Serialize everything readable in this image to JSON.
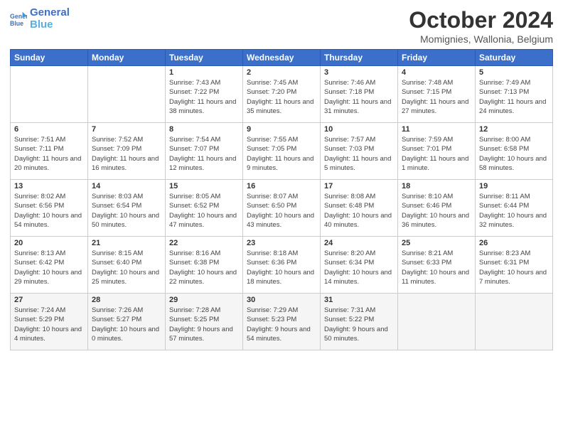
{
  "header": {
    "logo_line1": "General",
    "logo_line2": "Blue",
    "month": "October 2024",
    "location": "Momignies, Wallonia, Belgium"
  },
  "days_of_week": [
    "Sunday",
    "Monday",
    "Tuesday",
    "Wednesday",
    "Thursday",
    "Friday",
    "Saturday"
  ],
  "weeks": [
    [
      {
        "day": "",
        "info": ""
      },
      {
        "day": "",
        "info": ""
      },
      {
        "day": "1",
        "info": "Sunrise: 7:43 AM\nSunset: 7:22 PM\nDaylight: 11 hours and 38 minutes."
      },
      {
        "day": "2",
        "info": "Sunrise: 7:45 AM\nSunset: 7:20 PM\nDaylight: 11 hours and 35 minutes."
      },
      {
        "day": "3",
        "info": "Sunrise: 7:46 AM\nSunset: 7:18 PM\nDaylight: 11 hours and 31 minutes."
      },
      {
        "day": "4",
        "info": "Sunrise: 7:48 AM\nSunset: 7:15 PM\nDaylight: 11 hours and 27 minutes."
      },
      {
        "day": "5",
        "info": "Sunrise: 7:49 AM\nSunset: 7:13 PM\nDaylight: 11 hours and 24 minutes."
      }
    ],
    [
      {
        "day": "6",
        "info": "Sunrise: 7:51 AM\nSunset: 7:11 PM\nDaylight: 11 hours and 20 minutes."
      },
      {
        "day": "7",
        "info": "Sunrise: 7:52 AM\nSunset: 7:09 PM\nDaylight: 11 hours and 16 minutes."
      },
      {
        "day": "8",
        "info": "Sunrise: 7:54 AM\nSunset: 7:07 PM\nDaylight: 11 hours and 12 minutes."
      },
      {
        "day": "9",
        "info": "Sunrise: 7:55 AM\nSunset: 7:05 PM\nDaylight: 11 hours and 9 minutes."
      },
      {
        "day": "10",
        "info": "Sunrise: 7:57 AM\nSunset: 7:03 PM\nDaylight: 11 hours and 5 minutes."
      },
      {
        "day": "11",
        "info": "Sunrise: 7:59 AM\nSunset: 7:01 PM\nDaylight: 11 hours and 1 minute."
      },
      {
        "day": "12",
        "info": "Sunrise: 8:00 AM\nSunset: 6:58 PM\nDaylight: 10 hours and 58 minutes."
      }
    ],
    [
      {
        "day": "13",
        "info": "Sunrise: 8:02 AM\nSunset: 6:56 PM\nDaylight: 10 hours and 54 minutes."
      },
      {
        "day": "14",
        "info": "Sunrise: 8:03 AM\nSunset: 6:54 PM\nDaylight: 10 hours and 50 minutes."
      },
      {
        "day": "15",
        "info": "Sunrise: 8:05 AM\nSunset: 6:52 PM\nDaylight: 10 hours and 47 minutes."
      },
      {
        "day": "16",
        "info": "Sunrise: 8:07 AM\nSunset: 6:50 PM\nDaylight: 10 hours and 43 minutes."
      },
      {
        "day": "17",
        "info": "Sunrise: 8:08 AM\nSunset: 6:48 PM\nDaylight: 10 hours and 40 minutes."
      },
      {
        "day": "18",
        "info": "Sunrise: 8:10 AM\nSunset: 6:46 PM\nDaylight: 10 hours and 36 minutes."
      },
      {
        "day": "19",
        "info": "Sunrise: 8:11 AM\nSunset: 6:44 PM\nDaylight: 10 hours and 32 minutes."
      }
    ],
    [
      {
        "day": "20",
        "info": "Sunrise: 8:13 AM\nSunset: 6:42 PM\nDaylight: 10 hours and 29 minutes."
      },
      {
        "day": "21",
        "info": "Sunrise: 8:15 AM\nSunset: 6:40 PM\nDaylight: 10 hours and 25 minutes."
      },
      {
        "day": "22",
        "info": "Sunrise: 8:16 AM\nSunset: 6:38 PM\nDaylight: 10 hours and 22 minutes."
      },
      {
        "day": "23",
        "info": "Sunrise: 8:18 AM\nSunset: 6:36 PM\nDaylight: 10 hours and 18 minutes."
      },
      {
        "day": "24",
        "info": "Sunrise: 8:20 AM\nSunset: 6:34 PM\nDaylight: 10 hours and 14 minutes."
      },
      {
        "day": "25",
        "info": "Sunrise: 8:21 AM\nSunset: 6:33 PM\nDaylight: 10 hours and 11 minutes."
      },
      {
        "day": "26",
        "info": "Sunrise: 8:23 AM\nSunset: 6:31 PM\nDaylight: 10 hours and 7 minutes."
      }
    ],
    [
      {
        "day": "27",
        "info": "Sunrise: 7:24 AM\nSunset: 5:29 PM\nDaylight: 10 hours and 4 minutes."
      },
      {
        "day": "28",
        "info": "Sunrise: 7:26 AM\nSunset: 5:27 PM\nDaylight: 10 hours and 0 minutes."
      },
      {
        "day": "29",
        "info": "Sunrise: 7:28 AM\nSunset: 5:25 PM\nDaylight: 9 hours and 57 minutes."
      },
      {
        "day": "30",
        "info": "Sunrise: 7:29 AM\nSunset: 5:23 PM\nDaylight: 9 hours and 54 minutes."
      },
      {
        "day": "31",
        "info": "Sunrise: 7:31 AM\nSunset: 5:22 PM\nDaylight: 9 hours and 50 minutes."
      },
      {
        "day": "",
        "info": ""
      },
      {
        "day": "",
        "info": ""
      }
    ]
  ]
}
